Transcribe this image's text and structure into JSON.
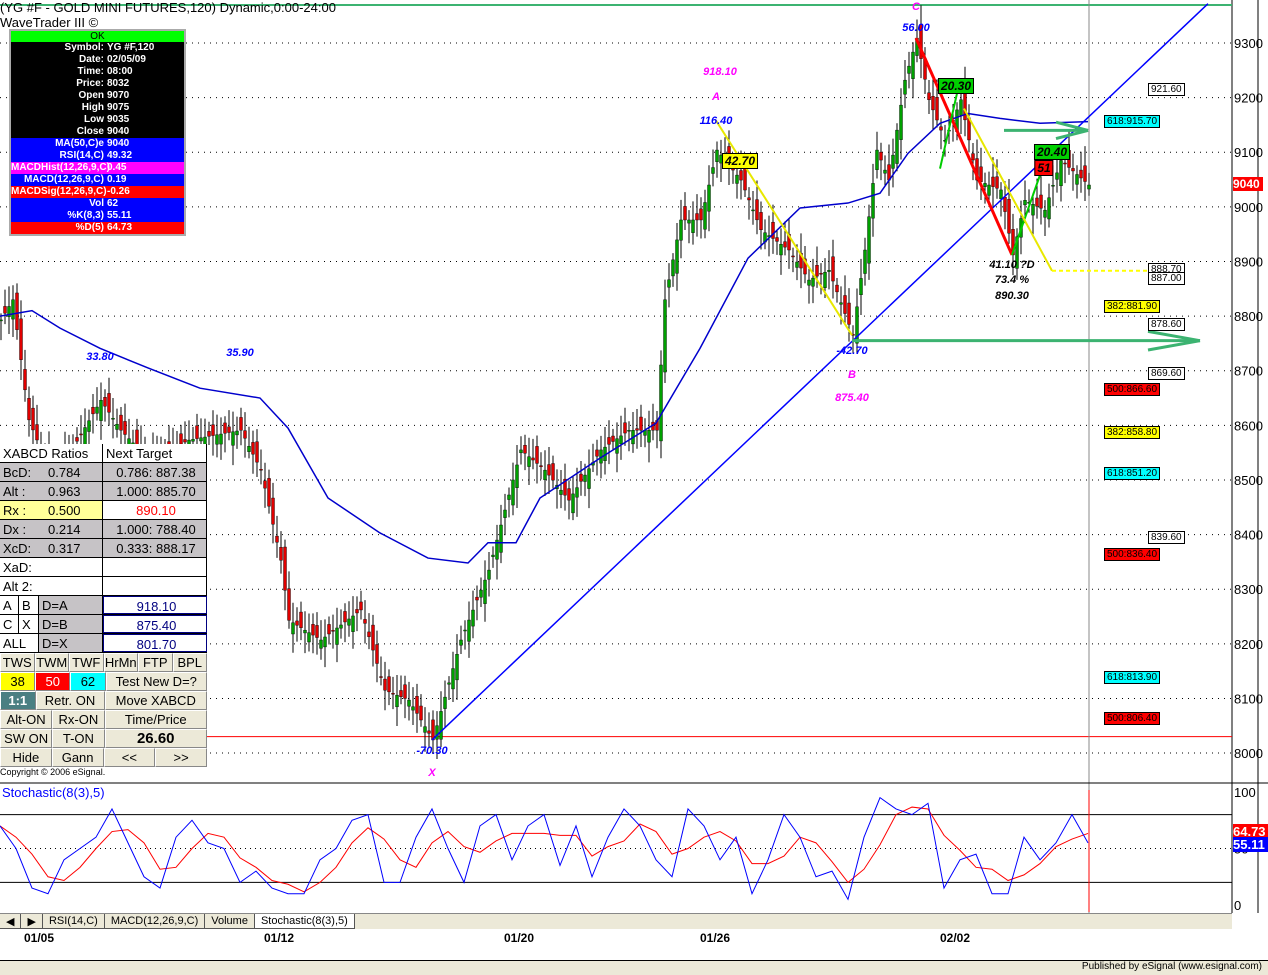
{
  "header": {
    "title": "(YG #F - GOLD MINI FUTURES,120) Dynamic,0:00-24:00",
    "subtitle": "WaveTrader III ©"
  },
  "data_window": {
    "status": "OK",
    "rows": [
      {
        "k": "Symbol:",
        "v": "YG #F,120",
        "bg": "#000000"
      },
      {
        "k": "Date:",
        "v": "02/05/09",
        "bg": "#000000"
      },
      {
        "k": "Time:",
        "v": "08:00",
        "bg": "#000000"
      },
      {
        "k": "Price:",
        "v": "8032",
        "bg": "#000000"
      },
      {
        "k": "Open",
        "v": "9070",
        "bg": "#000000"
      },
      {
        "k": "High",
        "v": "9075",
        "bg": "#000000"
      },
      {
        "k": "Low",
        "v": "9035",
        "bg": "#000000"
      },
      {
        "k": "Close",
        "v": "9040",
        "bg": "#000000"
      },
      {
        "k": "MA(50,C)e",
        "v": "9040",
        "bg": "#0000ff"
      },
      {
        "k": "RSI(14,C)",
        "v": "49.32",
        "bg": "#0000ff"
      },
      {
        "k": "MACDHist(12,26,9,C)",
        "v": "0.45",
        "bg": "#ff00ff"
      },
      {
        "k": "MACD(12,26,9,C)",
        "v": "0.19",
        "bg": "#0000ff"
      },
      {
        "k": "MACDSig(12,26,9,C)",
        "v": "-0.26",
        "bg": "#ff0000"
      },
      {
        "k": "Vol",
        "v": "62",
        "bg": "#0000ff"
      },
      {
        "k": "%K(8,3)",
        "v": "55.11",
        "bg": "#0000ff"
      },
      {
        "k": "%D(5)",
        "v": "64.73",
        "bg": "#ff0000"
      }
    ]
  },
  "xabcd": {
    "header": [
      "XABCD",
      "Ratios",
      "Next Target"
    ],
    "rows": [
      [
        "BcD:",
        "0.784",
        "0.786: 887.38"
      ],
      [
        "Alt  :",
        "0.963",
        "1.000: 885.70"
      ],
      [
        "Rx  :",
        "0.500",
        "890.10"
      ],
      [
        "Dx  :",
        "0.214",
        "1.000: 788.40"
      ],
      [
        "XcD:",
        "0.317",
        "0.333: 888.17"
      ],
      [
        "XaD:",
        "",
        ""
      ],
      [
        "Alt 2:",
        "",
        ""
      ]
    ],
    "targets": [
      {
        "a": "A",
        "b": "B",
        "lab": "D=A",
        "v": "918.10"
      },
      {
        "a": "C",
        "b": "X",
        "lab": "D=B",
        "v": "875.40"
      },
      {
        "a": "ALL",
        "b": "",
        "lab": "D=X",
        "v": "801.70"
      }
    ],
    "buttons1": [
      "TWS",
      "TWM",
      "TWF",
      "HrMn",
      "FTP",
      "BPL"
    ],
    "fib": [
      "38",
      "50",
      "62"
    ],
    "test": "Test New D=?",
    "ratio": "1:1",
    "retr": "Retr. ON",
    "move": "Move XABCD",
    "alt": "Alt-ON",
    "rx": "Rx-ON",
    "tp": "Time/Price",
    "sw": "SW ON",
    "t": "T-ON",
    "val": "26.60",
    "hide": "Hide",
    "gann": "Gann",
    "prev": "<<",
    "next": ">>",
    "copyright": "Copyright © 2006 eSignal."
  },
  "chart_data": {
    "type": "candlestick",
    "title": "YG #F - GOLD MINI FUTURES, 120 min",
    "price_axis": {
      "range": [
        7950,
        9370
      ],
      "ticks": [
        "9300",
        "9200",
        "9100",
        "9000",
        "8900",
        "8800",
        "8700",
        "8600",
        "8500",
        "8400",
        "8300",
        "8200",
        "8100",
        "8000"
      ]
    },
    "date_ticks": [
      {
        "bar": 3,
        "label": "01/05"
      },
      {
        "bar": 63,
        "label": "01/12"
      },
      {
        "bar": 123,
        "label": "01/20"
      },
      {
        "bar": 172,
        "label": "01/26"
      },
      {
        "bar": 232,
        "label": "02/02"
      }
    ],
    "close_path": [
      [
        0,
        8793
      ],
      [
        3,
        8830
      ],
      [
        7,
        8610
      ],
      [
        12,
        8518
      ],
      [
        17,
        8546
      ],
      [
        25,
        8646
      ],
      [
        30,
        8591
      ],
      [
        37,
        8537
      ],
      [
        47,
        8573
      ],
      [
        60,
        8591
      ],
      [
        65,
        8518
      ],
      [
        70,
        8353
      ],
      [
        72,
        8243
      ],
      [
        80,
        8207
      ],
      [
        90,
        8262
      ],
      [
        96,
        8115
      ],
      [
        102,
        8097
      ],
      [
        108,
        8024
      ],
      [
        115,
        8207
      ],
      [
        122,
        8335
      ],
      [
        130,
        8555
      ],
      [
        136,
        8518
      ],
      [
        142,
        8463
      ],
      [
        150,
        8555
      ],
      [
        157,
        8591
      ],
      [
        164,
        8591
      ],
      [
        166,
        8830
      ],
      [
        170,
        8976
      ],
      [
        175,
        8976
      ],
      [
        179,
        9104
      ],
      [
        185,
        9049
      ],
      [
        190,
        8958
      ],
      [
        197,
        8921
      ],
      [
        202,
        8866
      ],
      [
        207,
        8884
      ],
      [
        213,
        8765
      ],
      [
        216,
        8921
      ],
      [
        219,
        9104
      ],
      [
        222,
        9049
      ],
      [
        226,
        9232
      ],
      [
        229,
        9309
      ],
      [
        232,
        9196
      ],
      [
        236,
        9122
      ],
      [
        240,
        9196
      ],
      [
        244,
        9049
      ],
      [
        250,
        9031
      ],
      [
        253,
        8912
      ],
      [
        256,
        9012
      ],
      [
        261,
        8994
      ],
      [
        265,
        9085
      ],
      [
        272,
        9040
      ]
    ],
    "ma50": [
      [
        0,
        8800
      ],
      [
        8,
        8810
      ],
      [
        15,
        8778
      ],
      [
        25,
        8741
      ],
      [
        37,
        8705
      ],
      [
        50,
        8668
      ],
      [
        65,
        8650
      ],
      [
        72,
        8595
      ],
      [
        82,
        8467
      ],
      [
        95,
        8403
      ],
      [
        107,
        8357
      ],
      [
        117,
        8348
      ],
      [
        122,
        8385
      ],
      [
        129,
        8385
      ],
      [
        135,
        8467
      ],
      [
        150,
        8540
      ],
      [
        164,
        8604
      ],
      [
        175,
        8741
      ],
      [
        187,
        8906
      ],
      [
        200,
        8998
      ],
      [
        212,
        9007
      ],
      [
        220,
        9025
      ],
      [
        227,
        9098
      ],
      [
        235,
        9153
      ],
      [
        242,
        9171
      ],
      [
        250,
        9162
      ],
      [
        260,
        9153
      ],
      [
        272,
        9156
      ]
    ],
    "last_price": "9040",
    "cursor_price": 8030,
    "trendline": [
      [
        108,
        8024
      ],
      [
        302,
        9372
      ]
    ],
    "pattern_labels": [
      {
        "bar": 180,
        "p": 9246,
        "t": "918.10",
        "c": "#ff00ff"
      },
      {
        "bar": 179,
        "p": 9202,
        "t": "A",
        "c": "#ff00ff"
      },
      {
        "bar": 179,
        "p": 9158,
        "t": "116.40",
        "c": "#0000ff"
      },
      {
        "bar": 229,
        "p": 9328,
        "t": "56.00",
        "c": "#0000ff"
      },
      {
        "bar": 229,
        "p": 9365,
        "t": "C",
        "c": "#ff00ff"
      },
      {
        "bar": 213,
        "p": 8737,
        "t": "-42.70",
        "c": "#0000ff"
      },
      {
        "bar": 213,
        "p": 8692,
        "t": "B",
        "c": "#ff00ff"
      },
      {
        "bar": 213,
        "p": 8650,
        "t": "875.40",
        "c": "#ff00ff"
      },
      {
        "bar": 25,
        "p": 8725,
        "t": "33.80",
        "c": "#0000ff"
      },
      {
        "bar": 60,
        "p": 8733,
        "t": "35.90",
        "c": "#0000ff"
      },
      {
        "bar": 108,
        "p": 8003,
        "t": "-70.30",
        "c": "#0000ff"
      },
      {
        "bar": 108,
        "p": 7963,
        "t": "X",
        "c": "#ff00ff"
      },
      {
        "bar": 253,
        "p": 8893,
        "t": "41.10 ?D",
        "c": "#000000"
      },
      {
        "bar": 253,
        "p": 8866,
        "t": "73.4 %",
        "c": "#000000"
      },
      {
        "bar": 253,
        "p": 8837,
        "t": "890.30",
        "c": "#000000"
      }
    ],
    "ratio_boxes": [
      {
        "bar": 185,
        "p": 9084,
        "t": "42.70",
        "c": "#ffff00"
      },
      {
        "bar": 239,
        "p": 9222,
        "t": "20.30",
        "c": "#00d000"
      },
      {
        "bar": 263,
        "p": 9101,
        "t": "20.40",
        "c": "#00d000"
      },
      {
        "bar": 261,
        "p": 9071,
        "t": "51",
        "c": "#ff0000"
      }
    ],
    "levels": [
      {
        "p": 9216,
        "t": "921.60",
        "c": "#ffffff",
        "col": 2
      },
      {
        "p": 9157,
        "t": "618:915.70",
        "c": "#00ffff",
        "col": 1
      },
      {
        "p": 8887,
        "t": "888.70",
        "c": "#ffffff",
        "col": 2
      },
      {
        "p": 8870,
        "t": "887.00",
        "c": "#ffffff",
        "col": 2
      },
      {
        "p": 8819,
        "t": "382:881.90",
        "c": "#ffff00",
        "col": 1
      },
      {
        "p": 8786,
        "t": "878.60",
        "c": "#ffffff",
        "col": 2
      },
      {
        "p": 8696,
        "t": "869.60",
        "c": "#ffffff",
        "col": 2
      },
      {
        "p": 8666,
        "t": "500:866.60",
        "c": "#ff0000",
        "col": 1
      },
      {
        "p": 8588,
        "t": "382:858.80",
        "c": "#ffff00",
        "col": 1
      },
      {
        "p": 8512,
        "t": "618:851.20",
        "c": "#00ffff",
        "col": 1
      },
      {
        "p": 8396,
        "t": "839.60",
        "c": "#ffffff",
        "col": 2
      },
      {
        "p": 8364,
        "t": "500:836.40",
        "c": "#ff0000",
        "col": 1
      },
      {
        "p": 8139,
        "t": "618:813.90",
        "c": "#00ffff",
        "col": 1
      },
      {
        "p": 8064,
        "t": "500:806.40",
        "c": "#ff0000",
        "col": 1
      }
    ],
    "stochastic": {
      "title": "Stochastic(8(3),5)",
      "axis": [
        "100",
        "50",
        "0"
      ],
      "k_last": "55.11",
      "d_last": "64.73",
      "d_smoothing": 3,
      "k": [
        70,
        50,
        15,
        10,
        40,
        50,
        60,
        85,
        55,
        25,
        15,
        60,
        75,
        55,
        50,
        20,
        30,
        15,
        10,
        10,
        40,
        50,
        75,
        80,
        20,
        20,
        60,
        85,
        50,
        20,
        70,
        80,
        40,
        70,
        80,
        35,
        70,
        25,
        60,
        85,
        70,
        40,
        25,
        85,
        70,
        40,
        60,
        10,
        40,
        80,
        60,
        25,
        30,
        5,
        60,
        95,
        85,
        80,
        90,
        15,
        40,
        45,
        10,
        10,
        60,
        40,
        55,
        80,
        55
      ]
    }
  },
  "tabs": [
    "RSI(14,C)",
    "MACD(12,26,9,C)",
    "Volume",
    "Stochastic(8(3),5)"
  ],
  "status": "Published by eSignal (www.esignal.com)",
  "colors": {
    "bull": "#00a000",
    "bear": "#e00000",
    "ma": "#0000cc",
    "arrow": "#3cb371"
  }
}
